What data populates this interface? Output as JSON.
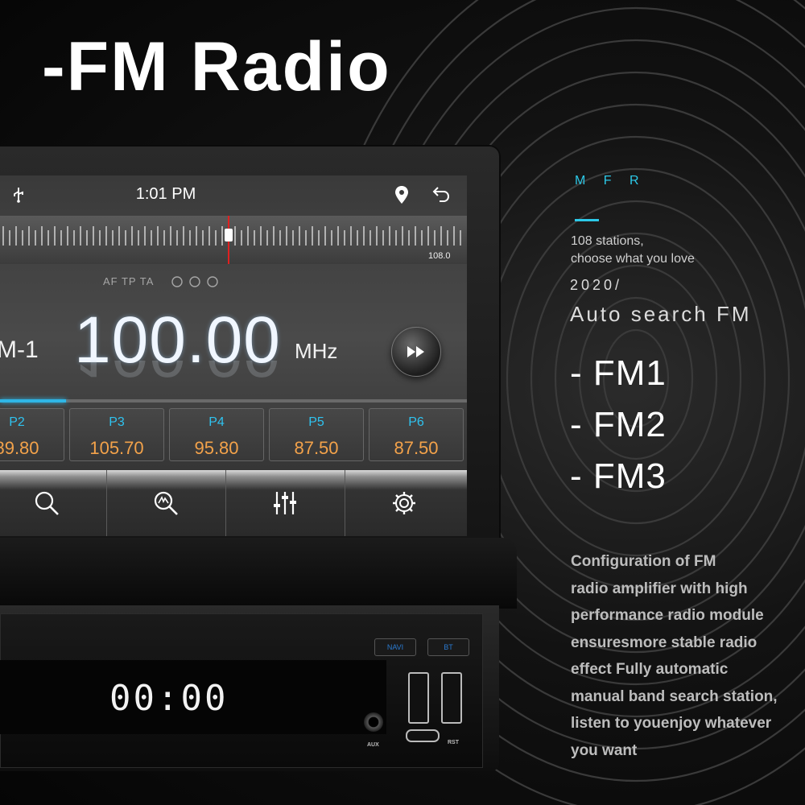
{
  "headline": "-FM Radio",
  "device_screen": {
    "status_bar": {
      "time": "1:01 PM",
      "icons": [
        "usb-icon",
        "location-pin-icon",
        "back-arrow-icon"
      ]
    },
    "tuner": {
      "max_label": "108.0"
    },
    "flags": "AF TP TA",
    "band": "M-1",
    "frequency": "100.00",
    "unit": "MHz",
    "next_button_icon": "fast-forward-icon",
    "presets": [
      {
        "name": "P2",
        "freq": "89.80"
      },
      {
        "name": "P3",
        "freq": "105.70"
      },
      {
        "name": "P4",
        "freq": "95.80"
      },
      {
        "name": "P5",
        "freq": "87.50"
      },
      {
        "name": "P6",
        "freq": "87.50"
      }
    ],
    "toolbar": [
      "search-icon",
      "auto-search-icon",
      "equalizer-icon",
      "settings-icon"
    ]
  },
  "head_unit": {
    "lcd_time": "00:00",
    "buttons": [
      "NAVI",
      "BT"
    ],
    "aux_label": "AUX",
    "rst_label": "RST"
  },
  "features": {
    "mfr": "M F R",
    "tagline": [
      "108 stations,",
      "choose what you love"
    ],
    "year": "2020/",
    "auto_search": "Auto search FM",
    "bands": [
      "- FM1",
      "- FM2",
      "- FM3"
    ],
    "description": [
      "Configuration of FM",
      "radio amplifier with high",
      "performance radio module",
      "ensuresmore stable radio",
      "effect Fully automatic",
      "manual band search station,",
      "listen to youenjoy whatever",
      "you want"
    ]
  },
  "colors": {
    "accent": "#2cc9e8",
    "preset_freq": "#f3a24a",
    "needle": "#e02020"
  }
}
